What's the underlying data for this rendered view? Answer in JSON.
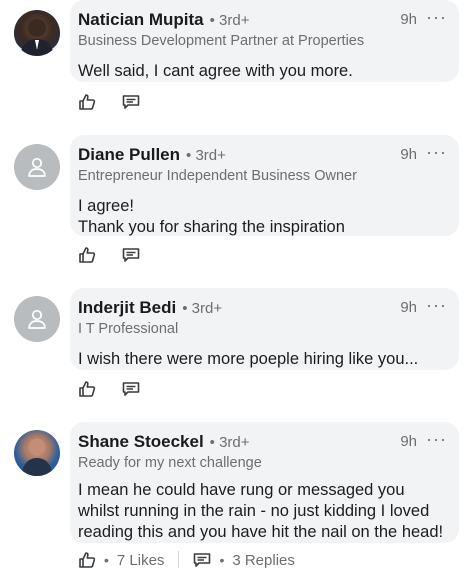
{
  "comments": [
    {
      "name": "Natician Mupita",
      "degree": "• 3rd+",
      "headline": "Business Development Partner at Properties",
      "time": "9h",
      "more": "···",
      "text": "Well said, I cant agree with you more."
    },
    {
      "name": "Diane Pullen",
      "degree": "• 3rd+",
      "headline": "Entrepreneur Independent Business Owner",
      "time": "9h",
      "more": "···",
      "text_lines": [
        "I agree!",
        "Thank you for sharing the inspiration"
      ]
    },
    {
      "name": "Inderjit Bedi",
      "degree": "• 3rd+",
      "headline": "I T Professional",
      "time": "9h",
      "more": "···",
      "text": "I wish there were more poeple hiring like you..."
    },
    {
      "name": "Shane Stoeckel",
      "degree": "• 3rd+",
      "headline": "Ready for my next challenge",
      "time": "9h",
      "more": "···",
      "text": "I mean he could have rung or messaged you whilst running in the rain - no just kidding I loved reading this and you have hit the nail on the head!",
      "likes": "7 Likes",
      "replies": "3 Replies"
    }
  ],
  "icons": {
    "like": "thumbs-up-icon",
    "reply": "reply-icon",
    "avatar_placeholder": "person-icon"
  },
  "colors": {
    "bubble": "#f2f3f5",
    "secondary_text": "#6b6e72",
    "placeholder_avatar": "#b9bcbe"
  }
}
